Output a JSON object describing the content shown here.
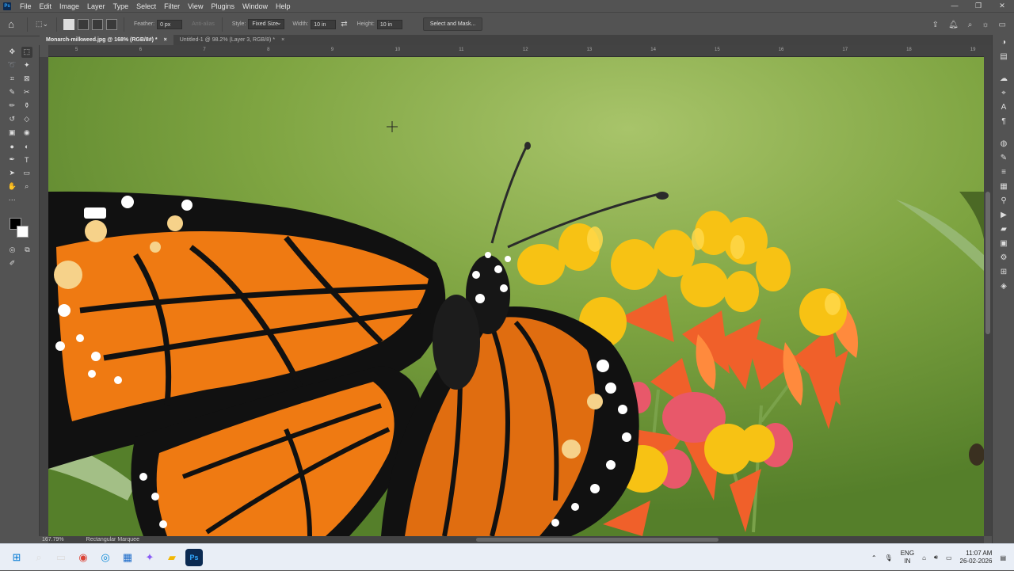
{
  "app": {
    "logo": "Ps",
    "accent": "#31a8ff"
  },
  "menu": [
    "File",
    "Edit",
    "Image",
    "Layer",
    "Type",
    "Select",
    "Filter",
    "View",
    "Plugins",
    "Window",
    "Help"
  ],
  "window_controls": [
    "—",
    "❐",
    "✕"
  ],
  "options": {
    "feather_label": "Feather:",
    "feather_value": "0 px",
    "anti_alias_label": "Anti-alias",
    "style_label": "Style:",
    "style_value": "Fixed Size",
    "width_label": "Width:",
    "width_value": "10 in",
    "height_label": "Height:",
    "height_value": "10 in",
    "select_mask_label": "Select and Mask..."
  },
  "tabs": [
    {
      "label": "Monarch-milkweed.jpg @ 168% (RGB/8#) *",
      "close": "×"
    },
    {
      "label": "Untitled-1 @ 98.2% (Layer 3, RGB/8) *",
      "close": "×"
    }
  ],
  "ruler_ticks": [
    "5",
    "6",
    "7",
    "8",
    "9",
    "10",
    "11",
    "12",
    "13",
    "14",
    "15",
    "16",
    "17",
    "18",
    "19"
  ],
  "status": {
    "zoom": "167.79%",
    "tool": "Rectangular Marquee"
  },
  "taskbar": {
    "lang_top": "ENG",
    "lang_bottom": "IN",
    "time": "11:07 AM",
    "date": "26-02-2026"
  },
  "colors": {
    "foreground": "#000000",
    "background": "#ffffff"
  }
}
